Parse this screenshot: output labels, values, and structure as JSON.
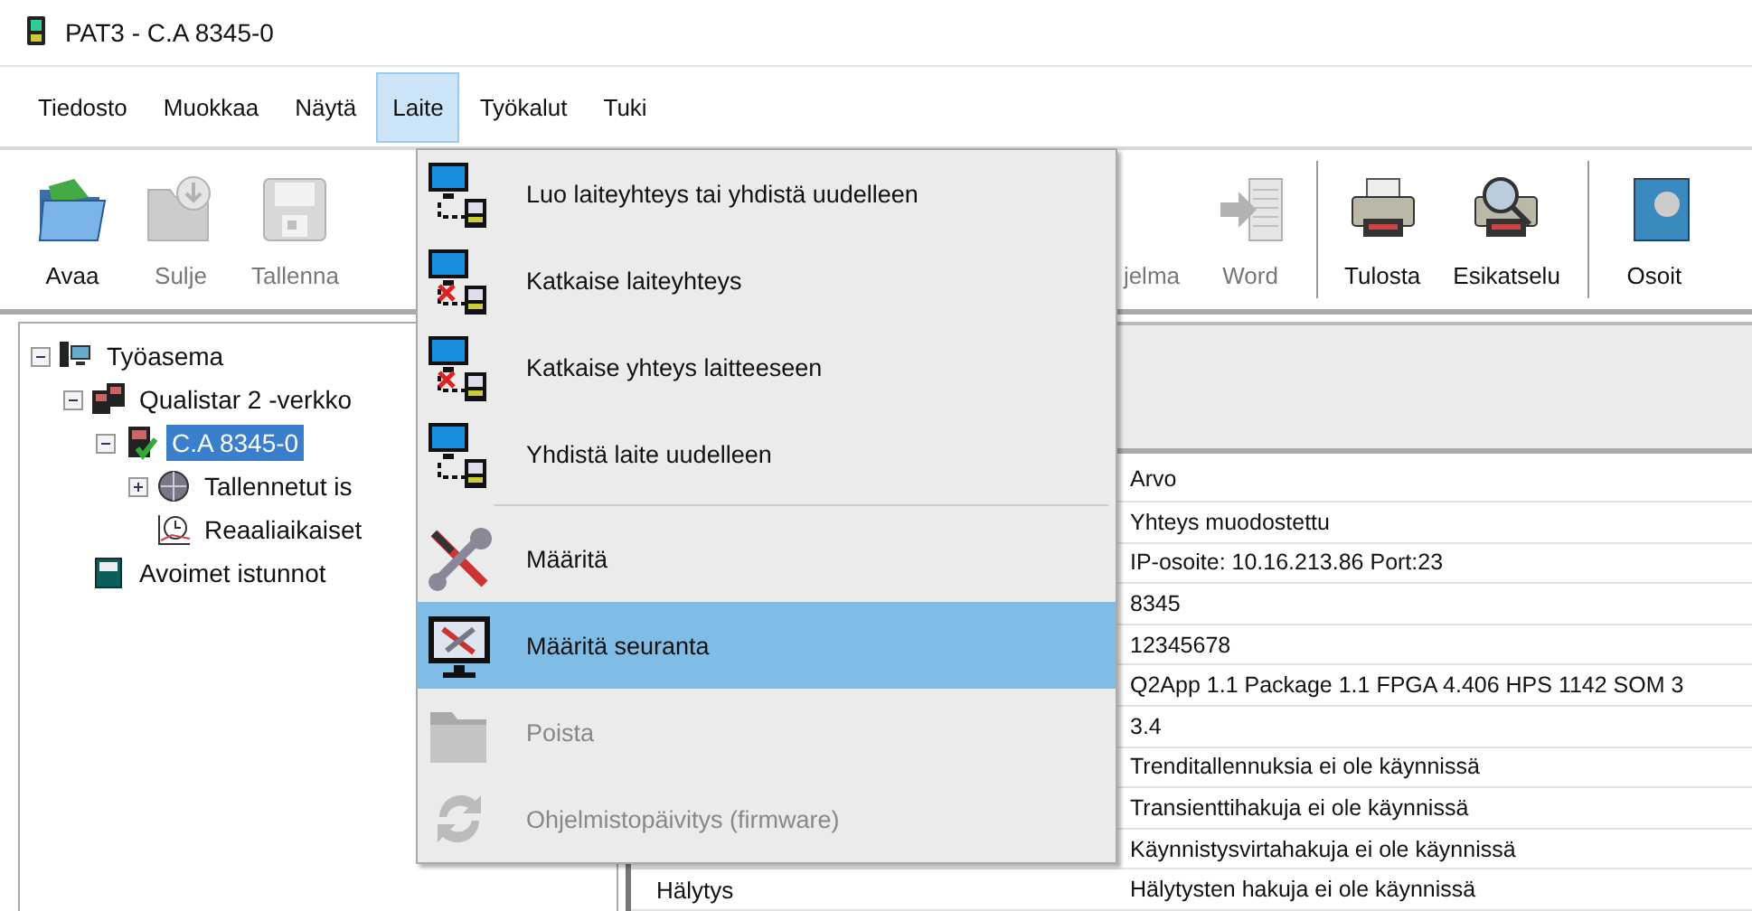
{
  "window": {
    "title": "PAT3 - C.A 8345-0"
  },
  "menu_bar": [
    {
      "label": "Tiedosto",
      "selected": false
    },
    {
      "label": "Muokkaa",
      "selected": false
    },
    {
      "label": "Näytä",
      "selected": false
    },
    {
      "label": "Laite",
      "selected": true
    },
    {
      "label": "Työkalut",
      "selected": false
    },
    {
      "label": "Tuki",
      "selected": false
    }
  ],
  "toolbar": [
    {
      "kind": "button",
      "label": "Avaa",
      "disabled": false
    },
    {
      "kind": "button",
      "label": "Sulje",
      "disabled": true
    },
    {
      "kind": "button",
      "label": "Tallenna",
      "disabled": true
    },
    {
      "kind": "gap"
    },
    {
      "kind": "button",
      "label": "jelma",
      "disabled": true
    },
    {
      "kind": "button",
      "label": "Word",
      "disabled": true
    },
    {
      "kind": "separator"
    },
    {
      "kind": "button",
      "label": "Tulosta",
      "disabled": false
    },
    {
      "kind": "button",
      "label": "Esikatselu",
      "disabled": false
    },
    {
      "kind": "separator"
    },
    {
      "kind": "button",
      "label": "Osoit",
      "disabled": false
    }
  ],
  "tree": [
    {
      "label": "Työasema",
      "expanded": true,
      "selected": false,
      "children": [
        {
          "label": "Qualistar 2 -verkko",
          "expanded": true,
          "selected": false,
          "children": [
            {
              "label": "C.A 8345-0",
              "expanded": true,
              "selected": true,
              "children": [
                {
                  "label": "Tallennetut is",
                  "expanded": false,
                  "selected": false
                },
                {
                  "label": "Reaaliaikaiset",
                  "selected": false
                }
              ]
            }
          ]
        },
        {
          "label": "Avoimet istunnot",
          "selected": false
        }
      ]
    }
  ],
  "table": {
    "header": {
      "column_2": "Arvo"
    },
    "rows": [
      {
        "column_2": "Yhteys muodostettu"
      },
      {
        "column_2": "IP-osoite: 10.16.213.86 Port:23"
      },
      {
        "column_2": "8345"
      },
      {
        "column_2": "12345678"
      },
      {
        "column_2": "Q2App 1.1 Package 1.1 FPGA 4.406 HPS 1142 SOM 3"
      },
      {
        "column_2": "3.4"
      },
      {
        "column_2": "Trenditallennuksia ei ole käynnissä"
      },
      {
        "column_2": "Transienttihakuja ei ole käynnissä"
      },
      {
        "column_2": "Käynnistysvirtahakuja ei ole käynnissä"
      },
      {
        "column_1": "Hälytys",
        "column_2": "Hälytysten hakuja ei ole käynnissä"
      }
    ]
  },
  "dropdown_menu": [
    {
      "kind": "item",
      "label": "Luo laiteyhteys tai yhdistä uudelleen",
      "disabled": false,
      "selected": false
    },
    {
      "kind": "item",
      "label": "Katkaise laiteyhteys",
      "disabled": false,
      "selected": false
    },
    {
      "kind": "item",
      "label": "Katkaise yhteys laitteeseen",
      "disabled": false,
      "selected": false
    },
    {
      "kind": "item",
      "label": "Yhdistä laite uudelleen",
      "disabled": false,
      "selected": false
    },
    {
      "kind": "separator"
    },
    {
      "kind": "item",
      "label": "Määritä",
      "disabled": false,
      "selected": false
    },
    {
      "kind": "item",
      "label": "Määritä seuranta",
      "disabled": false,
      "selected": true
    },
    {
      "kind": "item",
      "label": "Poista",
      "disabled": true,
      "selected": false
    },
    {
      "kind": "item",
      "label": "Ohjelmistopäivitys (firmware)",
      "disabled": true,
      "selected": false
    }
  ]
}
